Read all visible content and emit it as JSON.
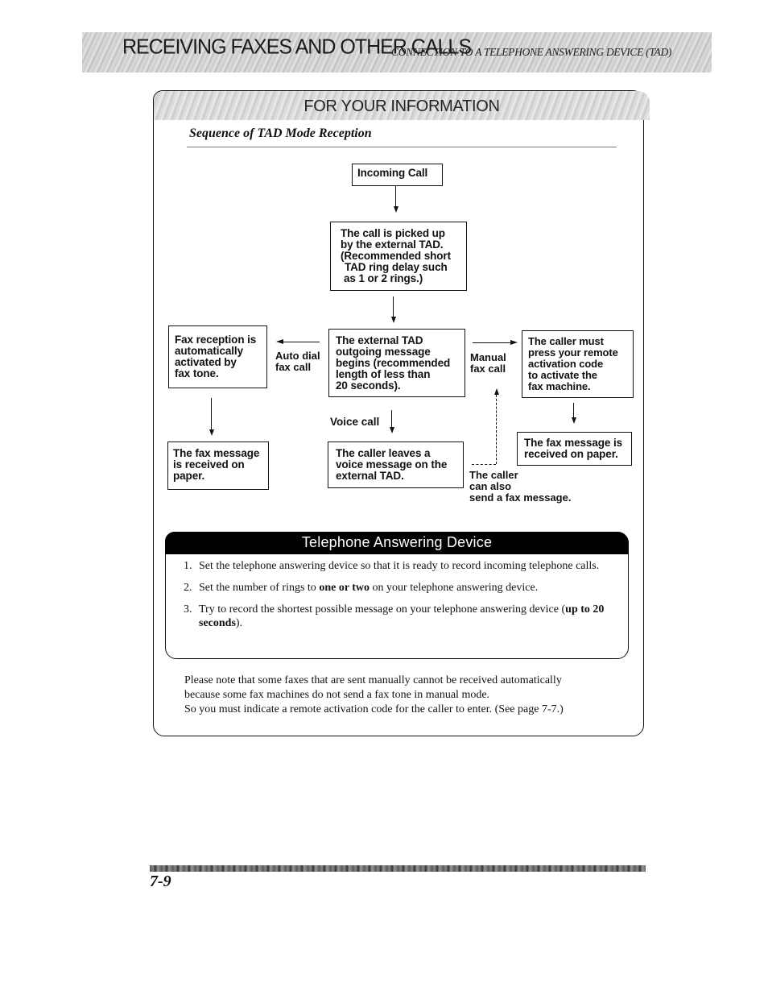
{
  "header": {
    "chapter_title": "RECEIVING FAXES AND OTHER CALLS",
    "section_title": "CONNECTION TO A TELEPHONE ANSWERING DEVICE (TAD)"
  },
  "fyi": {
    "title": "FOR YOUR INFORMATION",
    "heading": "Sequence of TAD Mode Reception",
    "flowchart": {
      "incoming_call": "Incoming Call",
      "picked_up": [
        "The call is picked up",
        "by the external TAD.",
        "(Recommended short",
        "TAD ring delay such",
        "as 1 or 2 rings.)"
      ],
      "outgoing_message": [
        "The external TAD",
        "outgoing message",
        "begins (recommended",
        "length of less than",
        "20 seconds)."
      ],
      "fax_reception_auto": [
        "Fax reception is",
        "automatically",
        "activated by",
        "fax tone."
      ],
      "caller_must_press": [
        "The caller must",
        "press your remote",
        "activation code",
        "to activate the",
        "fax machine."
      ],
      "fax_received_left": [
        "The fax message",
        "is received on",
        "paper."
      ],
      "caller_leaves_voice": [
        "The caller leaves a",
        "voice message on the",
        "external TAD."
      ],
      "fax_received_right": [
        "The fax message is",
        "received on paper."
      ],
      "labels": {
        "auto_dial": [
          "Auto dial",
          "fax call"
        ],
        "manual": [
          "Manual",
          "fax call"
        ],
        "voice_call": "Voice call",
        "caller_can_also": [
          "The caller",
          "can also",
          "send a fax message."
        ]
      }
    }
  },
  "tad": {
    "title": "Telephone Answering Device",
    "steps": [
      {
        "num": "1.",
        "text": "Set the telephone answering device so that it is ready to record incoming telephone calls."
      },
      {
        "num": "2.",
        "pre": "Set the number of rings to ",
        "bold": "one or two",
        "post": " on your telephone answering device."
      },
      {
        "num": "3.",
        "pre": "Try to record the shortest possible message on your telephone answering device (",
        "bold": "up to 20 seconds",
        "post": ")."
      }
    ]
  },
  "note": [
    "Please note that some faxes that are sent manually cannot be received automatically",
    "because some fax machines do not send a fax tone in manual mode.",
    "So you must indicate a remote activation code for the caller to enter. (See page 7-7.)"
  ],
  "footer": {
    "page_number": "7-9"
  }
}
